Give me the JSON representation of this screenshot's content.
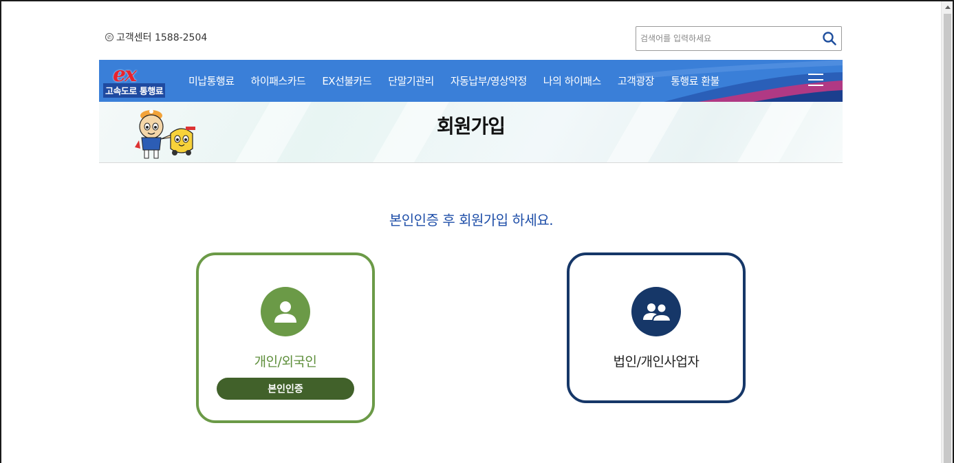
{
  "header": {
    "cs_label": "고객센터 1588-2504",
    "search_placeholder": "검색어를 입력하세요"
  },
  "logo": {
    "mark": "ex",
    "text": "고속도로 통행료"
  },
  "nav": {
    "items": [
      {
        "label": "미납통행료"
      },
      {
        "label": "하이패스카드"
      },
      {
        "label": "EX선불카드"
      },
      {
        "label": "단말기관리"
      },
      {
        "label": "자동납부/영상약정"
      },
      {
        "label": "나의 하이패스"
      },
      {
        "label": "고객광장"
      },
      {
        "label": "통행료 환불"
      }
    ]
  },
  "banner": {
    "title": "회원가입"
  },
  "main": {
    "guide": "본인인증 후 회원가입 하세요.",
    "cards": {
      "personal": {
        "label": "개인/외국인",
        "button": "본인인증",
        "icon": "person-icon"
      },
      "corporate": {
        "label": "법인/개인사업자",
        "icon": "group-icon"
      }
    }
  },
  "colors": {
    "nav_bg": "#3a7fd8",
    "title_blue": "#1e4ea8",
    "personal_green": "#6b9a47",
    "button_green": "#41612a",
    "corporate_navy": "#163768"
  }
}
